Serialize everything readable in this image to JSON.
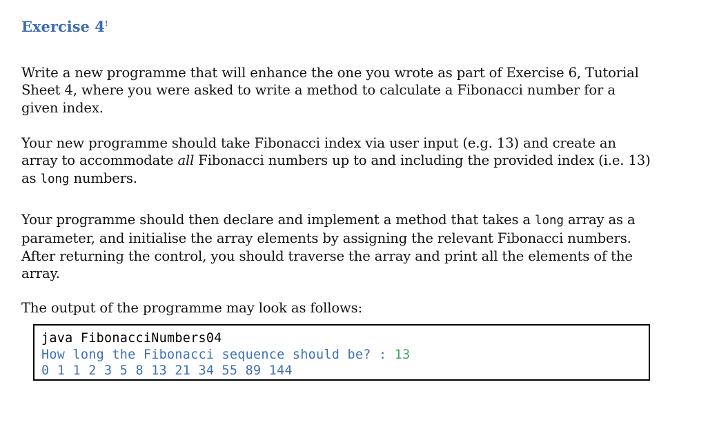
{
  "heading": {
    "text": "Exercise 4",
    "superscript": "!"
  },
  "paragraphs": {
    "p1": "Write a new programme that will enhance the one you wrote as part of Exercise 6, Tutorial Sheet 4, where you were asked to write a method to calculate a Fibonacci number for a given index.",
    "p2_a": "Your new programme should take Fibonacci index via user input (e.g. 13) and create an array to accommodate ",
    "p2_em": "all",
    "p2_b": " Fibonacci numbers up to and including the provided index (i.e. 13) as ",
    "p2_code": "long",
    "p2_c": " numbers.",
    "p3_a": "Your programme should then declare and implement a method that takes a ",
    "p3_code": "long",
    "p3_b": " array as a parameter, and initialise the array elements by assigning the relevant Fibonacci numbers. After returning the control, you should traverse the array and print all the elements of the array.",
    "p4": "The output of the programme may look as follows:"
  },
  "code_box": {
    "line1": "java FibonacciNumbers04",
    "line2_prompt": "How long the Fibonacci sequence should be? : ",
    "line2_value": "13",
    "line3": "0 1 1 2 3 5 8 13 21 34 55 89 144"
  },
  "colors": {
    "heading_blue": "#3c6db5",
    "console_blue": "#3b6fb8",
    "console_green": "#3cab5a",
    "text_black": "#111111",
    "box_border": "#000000",
    "page_background": "#ffffff"
  }
}
